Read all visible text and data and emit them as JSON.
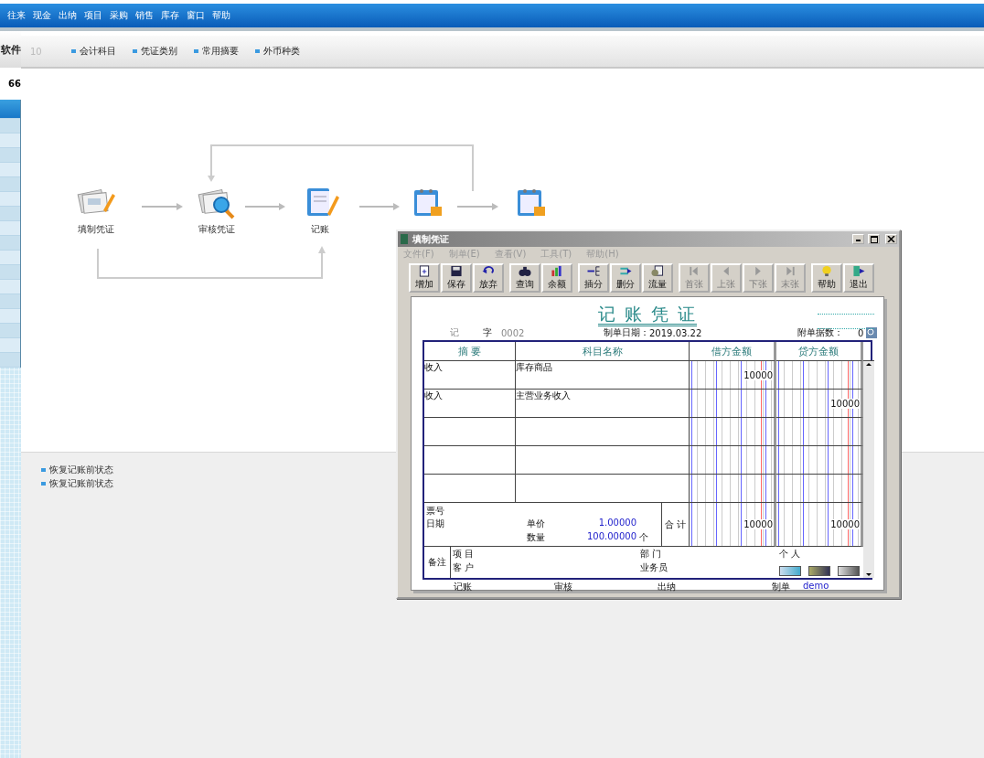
{
  "menu_bar": {
    "items": [
      "往来",
      "现金",
      "出纳",
      "项目",
      "采购",
      "销售",
      "库存",
      "窗口",
      "帮助"
    ]
  },
  "sidebar": {
    "header": "软件",
    "label": "66"
  },
  "toolbar": {
    "page_number": "10",
    "links": [
      "会计科目",
      "凭证类别",
      "常用摘要",
      "外币种类"
    ]
  },
  "flow": {
    "nodes": [
      {
        "label": "填制凭证",
        "kind": "fill"
      },
      {
        "label": "审核凭证",
        "kind": "review"
      },
      {
        "label": "记账",
        "kind": "post"
      },
      {
        "kind": "calendar"
      },
      {
        "kind": "calendar"
      }
    ]
  },
  "tasks": [
    "恢复记账前状态",
    "恢复记账前状态"
  ],
  "dialog": {
    "title": "填制凭证",
    "menu": [
      "文件(F)",
      "制单(E)",
      "查看(V)",
      "工具(T)",
      "帮助(H)"
    ],
    "tools": [
      [
        {
          "label": "增加",
          "kind": "add",
          "disabled": false
        },
        {
          "label": "保存",
          "kind": "save",
          "disabled": false
        },
        {
          "label": "放弃",
          "kind": "undo",
          "disabled": false
        }
      ],
      [
        {
          "label": "查询",
          "kind": "find",
          "disabled": false
        },
        {
          "label": "余额",
          "kind": "chart",
          "disabled": false
        }
      ],
      [
        {
          "label": "插分",
          "kind": "insert",
          "disabled": false
        },
        {
          "label": "删分",
          "kind": "delete",
          "disabled": false
        },
        {
          "label": "流量",
          "kind": "flow",
          "disabled": false
        }
      ],
      [
        {
          "label": "首张",
          "kind": "first",
          "disabled": true
        },
        {
          "label": "上张",
          "kind": "prev",
          "disabled": true
        },
        {
          "label": "下张",
          "kind": "next",
          "disabled": true
        },
        {
          "label": "末张",
          "kind": "last",
          "disabled": true
        }
      ],
      [
        {
          "label": "帮助",
          "kind": "help",
          "disabled": false
        },
        {
          "label": "退出",
          "kind": "exit",
          "disabled": false
        }
      ]
    ],
    "voucher": {
      "title": "记 账 凭 证",
      "type_label": "记",
      "word_label": "字",
      "number": "0002",
      "date_label": "制单日期：",
      "date": "2019.03.22",
      "attachments_label": "附单据数：",
      "attachments": "0",
      "columns": [
        "摘 要",
        "科目名称",
        "借方金额",
        "贷方金额"
      ],
      "rows": [
        {
          "summary": "收入",
          "account": "库存商品",
          "debit": "10000"
        },
        {
          "summary": "收入",
          "account": "主营业务收入",
          "credit": "10000"
        }
      ],
      "ticket_label": "票号",
      "date_field_label": "日期",
      "unit_price_label": "单价",
      "unit_price": "1.00000",
      "quantity_label": "数量",
      "quantity": "100.00000",
      "unit": "个",
      "total_label": "合 计",
      "debit_total": "10000",
      "credit_total": "10000",
      "remarks_label": "备注",
      "project_label": "项 目",
      "customer_label": "客 户",
      "department_label": "部 门",
      "salesperson_label": "业务员",
      "person_label": "个 人",
      "signatures": [
        {
          "label": "记账"
        },
        {
          "label": "审核"
        },
        {
          "label": "出纳"
        },
        {
          "label": "制单",
          "value": "demo"
        }
      ]
    }
  }
}
